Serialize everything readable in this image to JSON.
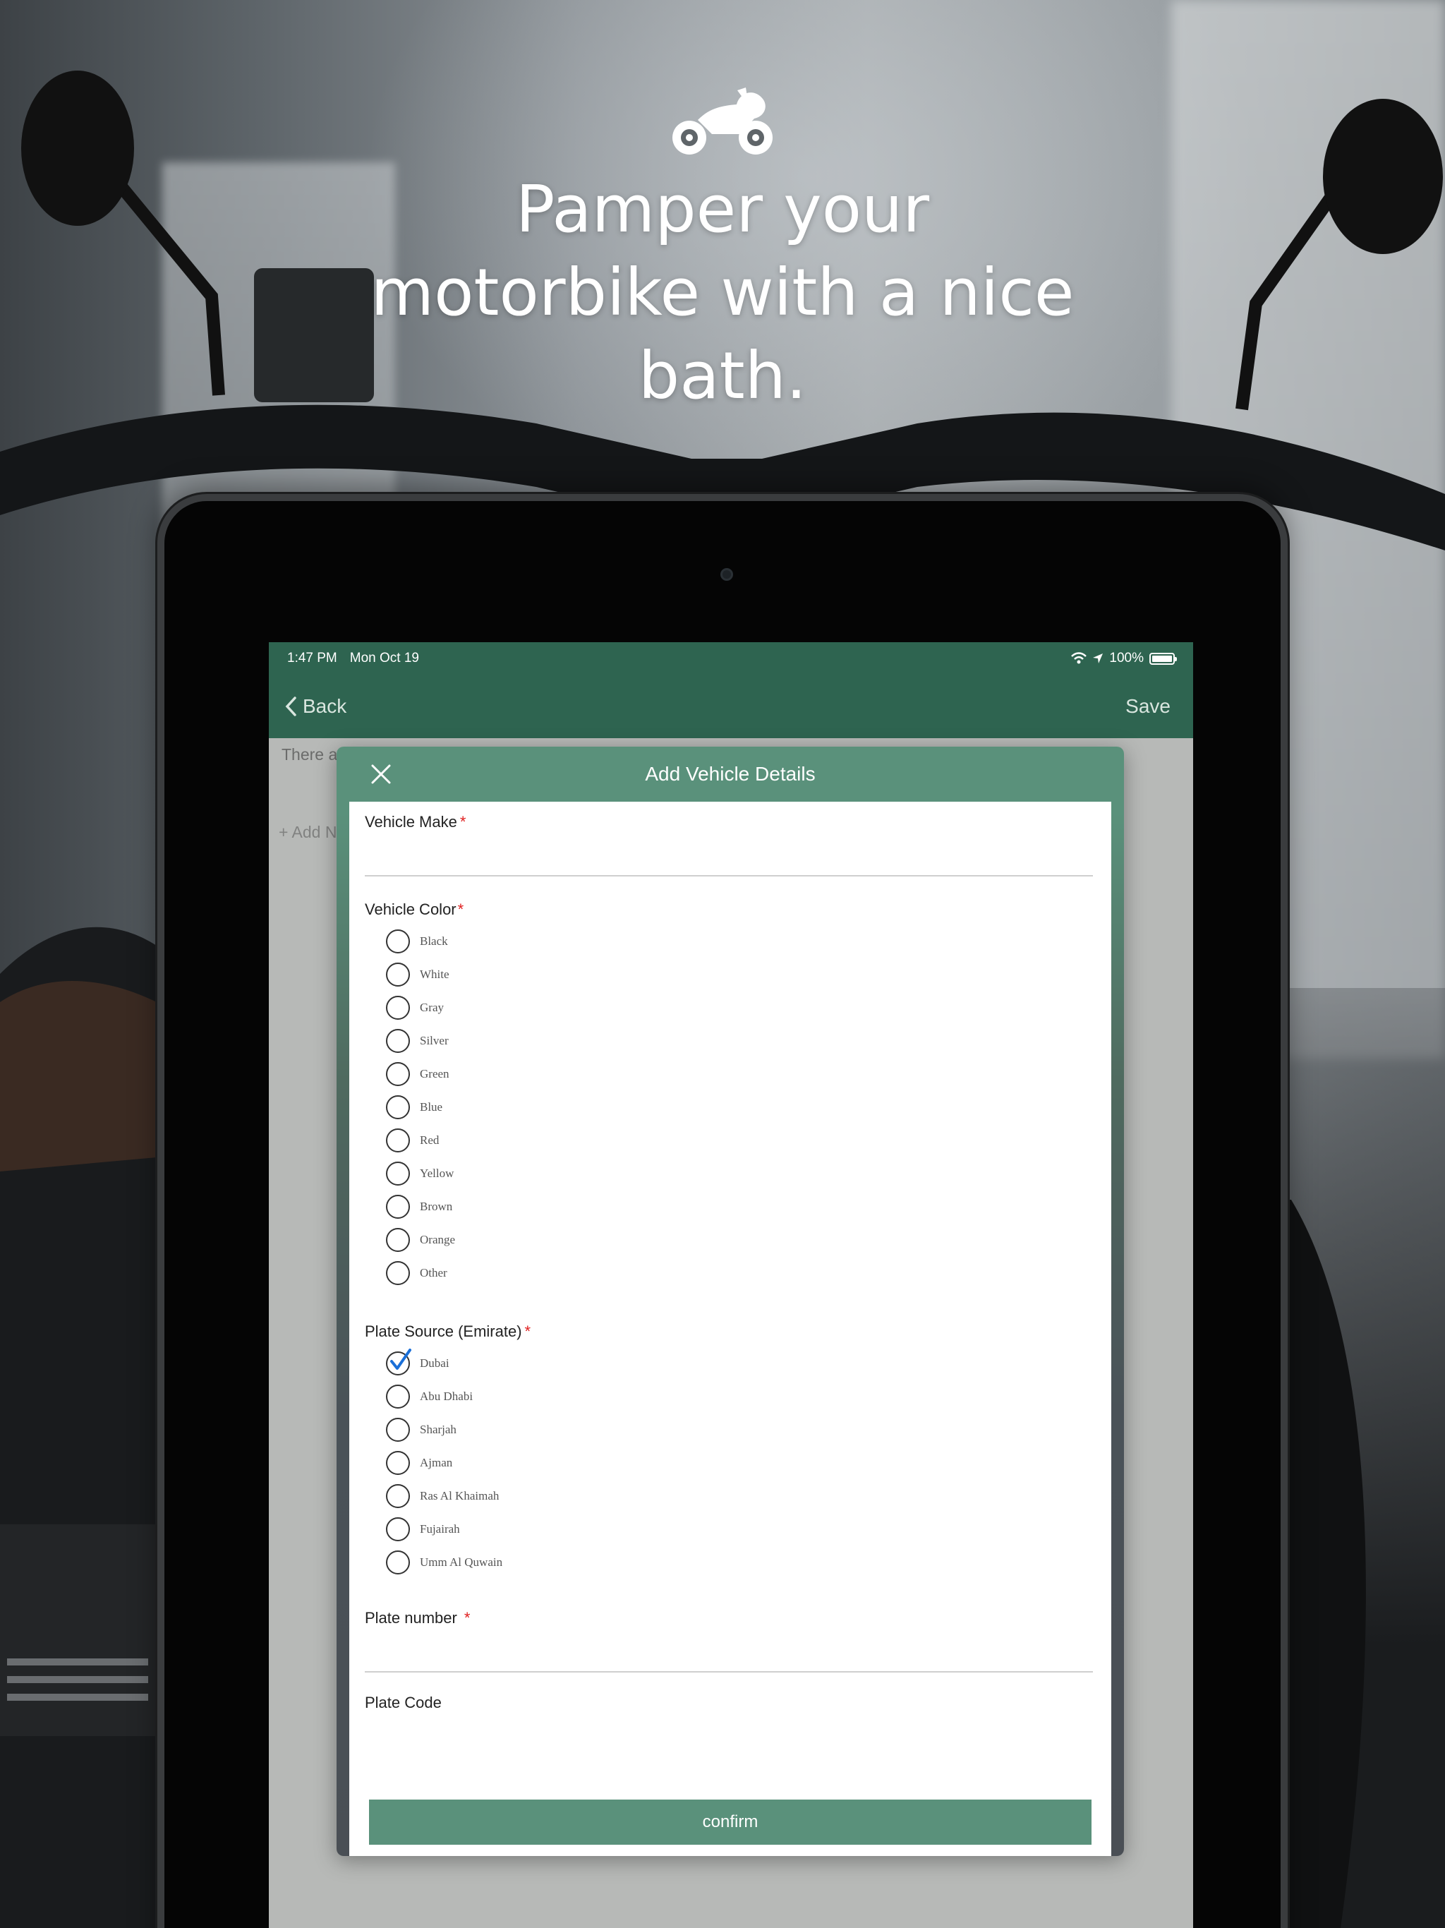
{
  "hero": {
    "title": "Pamper your motorbike with a nice bath.",
    "icon": "motorbike-icon"
  },
  "status_bar": {
    "time": "1:47 PM",
    "date": "Mon Oct 19",
    "battery": "100%"
  },
  "nav": {
    "back_label": "Back",
    "save_label": "Save"
  },
  "background_screen": {
    "text_fragment": "There a",
    "add_fragment": "+ Add N"
  },
  "modal": {
    "title": "Add Vehicle Details",
    "vehicle_make": {
      "label": "Vehicle Make",
      "value": ""
    },
    "vehicle_color": {
      "label": "Vehicle Color",
      "options": [
        "Black",
        "White",
        "Gray",
        "Silver",
        "Green",
        "Blue",
        "Red",
        "Yellow",
        "Brown",
        "Orange",
        "Other"
      ],
      "selected": null
    },
    "plate_source": {
      "label": "Plate Source (Emirate)",
      "options": [
        "Dubai",
        "Abu Dhabi",
        "Sharjah",
        "Ajman",
        "Ras Al Khaimah",
        "Fujairah",
        "Umm Al Quwain"
      ],
      "selected": "Dubai"
    },
    "plate_number": {
      "label": "Plate number",
      "value": ""
    },
    "plate_code": {
      "label": "Plate Code",
      "value": ""
    },
    "required_marker": "*",
    "confirm_label": "confirm"
  },
  "colors": {
    "brand_green": "#2e6450",
    "modal_green": "#5a917b",
    "required_red": "#e02020",
    "check_blue": "#1a6fd8"
  }
}
